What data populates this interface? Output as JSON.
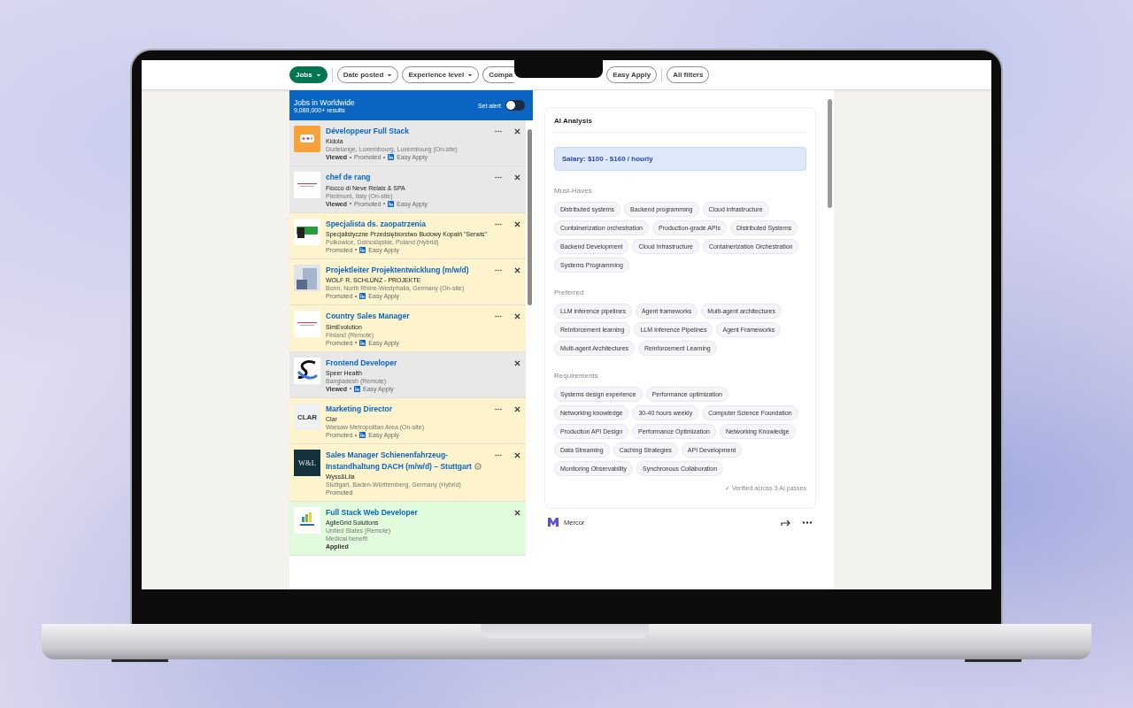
{
  "filters": [
    {
      "label": "Jobs",
      "selected": true,
      "caret": true
    },
    {
      "label": "Date posted",
      "selected": false,
      "caret": true
    },
    {
      "label": "Experience level",
      "selected": false,
      "caret": true
    },
    {
      "label": "Compa",
      "selected": false,
      "caret": false
    },
    {
      "label": "Easy Apply",
      "selected": false,
      "caret": false
    },
    {
      "label": "All filters",
      "selected": false,
      "caret": false
    }
  ],
  "header": {
    "title": "Jobs in Worldwide",
    "count": "9,089,000+ results",
    "alert": {
      "label": "Set alert",
      "on": false
    }
  },
  "jobs": [
    {
      "title": "Développeur Full Stack",
      "company": "Kidola",
      "location": "Dudelange, Luxembourg, Luxembourg (On-site)",
      "logo": {
        "kind": "orange"
      },
      "menu": true,
      "verified": false,
      "meta": [
        {
          "kind": "viewed",
          "text": "Viewed"
        },
        {
          "kind": "promoted",
          "text": "Promoted"
        },
        {
          "kind": "easy_apply",
          "text": "Easy Apply"
        }
      ]
    },
    {
      "title": "chef de rang",
      "company": "Fiocco di Neve Relais & SPA",
      "location": "Piedmont, Italy (On-site)",
      "logo": {
        "kind": "script"
      },
      "menu": true,
      "verified": false,
      "meta": [
        {
          "kind": "viewed",
          "text": "Viewed"
        },
        {
          "kind": "promoted",
          "text": "Promoted"
        },
        {
          "kind": "easy_apply",
          "text": "Easy Apply"
        }
      ]
    },
    {
      "title": "Specjalista ds. zaopatrzenia",
      "company": "Specjalistyczne Przedsiębiorstwo Budowy Kopalń \"Serwis\"",
      "location": "Polkowice, Dolnośląskie, Poland (Hybrid)",
      "logo": {
        "kind": "green"
      },
      "menu": true,
      "verified": false,
      "meta": [
        {
          "kind": "promoted",
          "text": "Promoted"
        },
        {
          "kind": "easy_apply",
          "text": "Easy Apply"
        }
      ]
    },
    {
      "title": "Projektleiter Projektentwicklung (m/w/d)",
      "company": "WOLF R. SCHLÜNZ - PROJEKTE",
      "location": "Bonn, North Rhine-Westphalia, Germany (On-site)",
      "logo": {
        "kind": "blocks"
      },
      "menu": true,
      "verified": false,
      "meta": [
        {
          "kind": "promoted",
          "text": "Promoted"
        },
        {
          "kind": "easy_apply",
          "text": "Easy Apply"
        }
      ]
    },
    {
      "title": "Country Sales Manager",
      "company": "SimEvolution",
      "location": "Finland (Remote)",
      "logo": {
        "kind": "script"
      },
      "menu": true,
      "verified": false,
      "meta": [
        {
          "kind": "promoted",
          "text": "Promoted"
        },
        {
          "kind": "easy_apply",
          "text": "Easy Apply"
        }
      ]
    },
    {
      "title": "Frontend Developer",
      "company": "Speer Health",
      "location": "Bangladesh (Remote)",
      "logo": {
        "kind": "swoosh"
      },
      "menu": false,
      "verified": false,
      "meta": [
        {
          "kind": "viewed",
          "text": "Viewed"
        },
        {
          "kind": "easy_apply",
          "text": "Easy Apply"
        }
      ]
    },
    {
      "title": "Marketing Director",
      "company": "Clar",
      "location": "Warsaw Metropolitan Area (On-site)",
      "logo": {
        "kind": "text_light",
        "text": "CLAR"
      },
      "menu": true,
      "verified": false,
      "meta": [
        {
          "kind": "promoted",
          "text": "Promoted"
        },
        {
          "kind": "easy_apply",
          "text": "Easy Apply"
        }
      ]
    },
    {
      "title": "Sales Manager Schienenfahrzeug-Instandhaltung DACH (m/w/d) – Stuttgart",
      "company": "Wyss&Lila",
      "location": "Stuttgart, Baden-Württemberg, Germany (Hybrid)",
      "logo": {
        "kind": "text_dark",
        "text": "W&L"
      },
      "menu": true,
      "verified": true,
      "meta": [
        {
          "kind": "promoted",
          "text": "Promoted"
        }
      ]
    },
    {
      "title": "Full Stack Web Developer",
      "company": "AgileGrid Solutions",
      "location": "United States (Remote)",
      "benefit": "Medical benefit",
      "logo": {
        "kind": "chart"
      },
      "menu": false,
      "verified": false,
      "meta": [
        {
          "kind": "applied",
          "text": "Applied"
        }
      ]
    }
  ],
  "analysis": {
    "title": "AI Analysis",
    "salary": "Salary: $100 - $160 / hourly",
    "sections": [
      {
        "title": "Must-Haves",
        "tags": [
          "Distributed systems",
          "Backend programming",
          "Cloud infrastructure",
          "Containerization orchestration",
          "Production-grade APIs",
          "Distributed Systems",
          "Backend Development",
          "Cloud Infrastructure",
          "Containerization Orchestration",
          "Systems Programming"
        ]
      },
      {
        "title": "Preferred",
        "tags": [
          "LLM inference pipelines",
          "Agent frameworks",
          "Multi-agent architectures",
          "Reinforcement learning",
          "LLM Inference Pipelines",
          "Agent Frameworks",
          "Multi-agent Architectures",
          "Reinforcement Learning"
        ]
      },
      {
        "title": "Requirements",
        "tags": [
          "Systems design experience",
          "Performance optimization",
          "Networking knowledge",
          "30-40 hours weekly",
          "Computer Science Foundation",
          "Production API Design",
          "Performance Optimization",
          "Networking Knowledge",
          "Data Streaming",
          "Caching Strategies",
          "API Development",
          "Monitoring Observability",
          "Synchronous Collaboration"
        ]
      }
    ],
    "footer": "✓ Verified across 3 AI passes"
  },
  "company_footer": {
    "name": "Mercor"
  }
}
